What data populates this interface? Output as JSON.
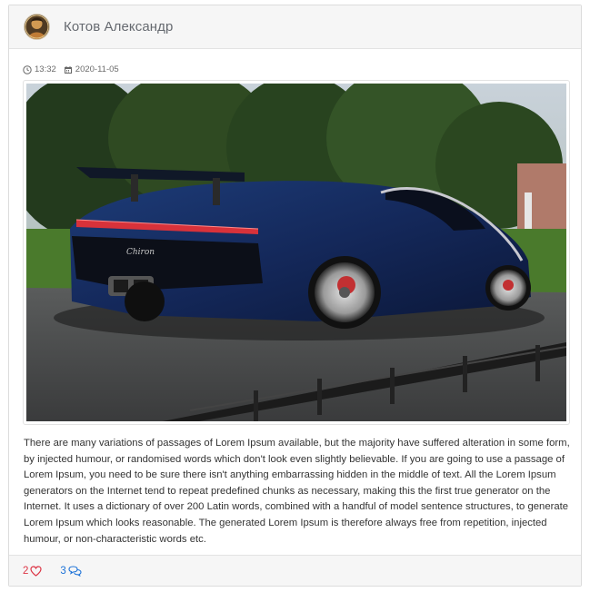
{
  "post": {
    "author": "Котов Александр",
    "avatar_icon": "user-avatar",
    "time": "13:32",
    "date": "2020-11-05",
    "image_icon": "car-photo",
    "text": "There are many variations of passages of Lorem Ipsum available, but the majority have suffered alteration in some form, by injected humour, or randomised words which don't look even slightly believable. If you are going to use a passage of Lorem Ipsum, you need to be sure there isn't anything embarrassing hidden in the middle of text. All the Lorem Ipsum generators on the Internet tend to repeat predefined chunks as necessary, making this the first true generator on the Internet. It uses a dictionary of over 200 Latin words, combined with a handful of model sentence structures, to generate Lorem Ipsum which looks reasonable. The generated Lorem Ipsum is therefore always free from repetition, injected humour, or non-characteristic words etc.",
    "likes": "2",
    "comments": "3"
  },
  "colors": {
    "likes": "#dc3545",
    "comments": "#1e73d8",
    "header_bg": "#f6f6f6"
  }
}
